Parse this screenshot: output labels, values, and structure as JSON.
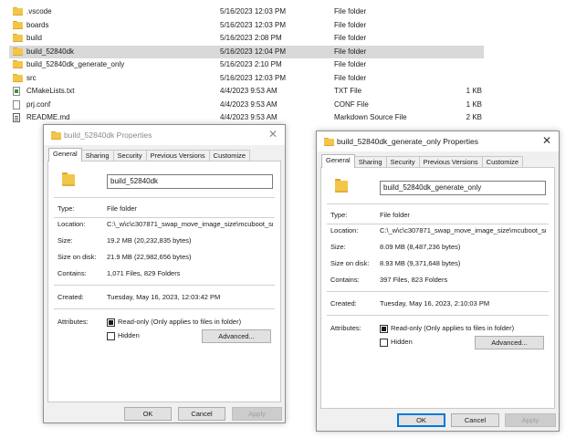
{
  "files": [
    {
      "name": ".vscode",
      "date": "5/16/2023 12:03 PM",
      "type": "File folder",
      "size": "",
      "icon": "folder-icon",
      "selected": false
    },
    {
      "name": "boards",
      "date": "5/16/2023 12:03 PM",
      "type": "File folder",
      "size": "",
      "icon": "folder-icon",
      "selected": false
    },
    {
      "name": "build",
      "date": "5/16/2023 2:08 PM",
      "type": "File folder",
      "size": "",
      "icon": "folder-icon",
      "selected": false
    },
    {
      "name": "build_52840dk",
      "date": "5/16/2023 12:04 PM",
      "type": "File folder",
      "size": "",
      "icon": "folder-icon",
      "selected": true
    },
    {
      "name": "build_52840dk_generate_only",
      "date": "5/16/2023 2:10 PM",
      "type": "File folder",
      "size": "",
      "icon": "folder-icon",
      "selected": false
    },
    {
      "name": "src",
      "date": "5/16/2023 12:03 PM",
      "type": "File folder",
      "size": "",
      "icon": "folder-icon",
      "selected": false
    },
    {
      "name": "CMakeLists.txt",
      "date": "4/4/2023 9:53 AM",
      "type": "TXT File",
      "size": "1 KB",
      "icon": "text-file-icon",
      "selected": false
    },
    {
      "name": "prj.conf",
      "date": "4/4/2023 9:53 AM",
      "type": "CONF File",
      "size": "1 KB",
      "icon": "conf-file-icon",
      "selected": false
    },
    {
      "name": "README.md",
      "date": "4/4/2023 9:53 AM",
      "type": "Markdown Source File",
      "size": "2 KB",
      "icon": "markdown-file-icon",
      "selected": false
    }
  ],
  "dialog_left": {
    "title": "build_52840dk Properties",
    "tabs": [
      "General",
      "Sharing",
      "Security",
      "Previous Versions",
      "Customize"
    ],
    "active_tab": "General",
    "name": "build_52840dk",
    "type_label": "Type:",
    "type_value": "File folder",
    "location_label": "Location:",
    "location_value": "C:\\_w\\c\\c307871_swap_move_image_size\\mcuboot_sn",
    "size_label": "Size:",
    "size_value": "19.2 MB (20,232,835 bytes)",
    "size_on_disk_label": "Size on disk:",
    "size_on_disk_value": "21.9 MB (22,982,656 bytes)",
    "contains_label": "Contains:",
    "contains_value": "1,071 Files, 829 Folders",
    "created_label": "Created:",
    "created_value": "Tuesday, May 16, 2023, 12:03:42 PM",
    "attributes_label": "Attributes:",
    "readonly_label": "Read-only (Only applies to files in folder)",
    "hidden_label": "Hidden",
    "advanced_label": "Advanced...",
    "ok_label": "OK",
    "cancel_label": "Cancel",
    "apply_label": "Apply"
  },
  "dialog_right": {
    "title": "build_52840dk_generate_only Properties",
    "tabs": [
      "General",
      "Sharing",
      "Security",
      "Previous Versions",
      "Customize"
    ],
    "active_tab": "General",
    "name": "build_52840dk_generate_only",
    "type_label": "Type:",
    "type_value": "File folder",
    "location_label": "Location:",
    "location_value": "C:\\_w\\c\\c307871_swap_move_image_size\\mcuboot_sn",
    "size_label": "Size:",
    "size_value": "8.09 MB (8,487,236 bytes)",
    "size_on_disk_label": "Size on disk:",
    "size_on_disk_value": "8.93 MB (9,371,648 bytes)",
    "contains_label": "Contains:",
    "contains_value": "397 Files, 823 Folders",
    "created_label": "Created:",
    "created_value": "Tuesday, May 16, 2023, 2:10:03 PM",
    "attributes_label": "Attributes:",
    "readonly_label": "Read-only (Only applies to files in folder)",
    "hidden_label": "Hidden",
    "advanced_label": "Advanced...",
    "ok_label": "OK",
    "cancel_label": "Cancel",
    "apply_label": "Apply"
  },
  "close_glyph": "✕",
  "colors": {
    "selection": "#d9d9d9",
    "folder": "#f3c648",
    "accent": "#0078d7"
  }
}
